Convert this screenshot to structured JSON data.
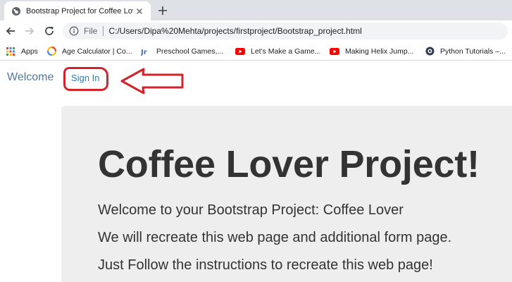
{
  "browser": {
    "tab": {
      "title": "Bootstrap Project for Coffee Love",
      "favicon": "globe-icon"
    },
    "address": {
      "scheme_label": "File",
      "url": "C:/Users/Dipa%20Mehta/projects/firstproject/Bootstrap_project.html"
    },
    "bookmarks": [
      {
        "label": "Apps",
        "icon": "apps-grid-icon"
      },
      {
        "label": "Age Calculator | Co...",
        "icon": "age-calculator-icon"
      },
      {
        "label": "Preschool Games,...",
        "icon": "preschool-games-icon"
      },
      {
        "label": "Let's Make a Game...",
        "icon": "youtube-icon"
      },
      {
        "label": "Making Helix Jump...",
        "icon": "youtube-icon"
      },
      {
        "label": "Python Tutorials –...",
        "icon": "python-tutorials-icon"
      }
    ]
  },
  "navbar": {
    "brand": "Welcome",
    "signin": "Sign In"
  },
  "jumbotron": {
    "title": "Coffee Lover Project!",
    "lines": [
      "Welcome to your Bootstrap Project: Coffee Lover",
      "We will recreate this web page and additional form page.",
      "Just Follow the instructions to recreate this web page!"
    ]
  },
  "colors": {
    "annotation_red": "#d2232a",
    "link_blue": "#337ab7",
    "jumbotron_bg": "#eeeeee"
  }
}
